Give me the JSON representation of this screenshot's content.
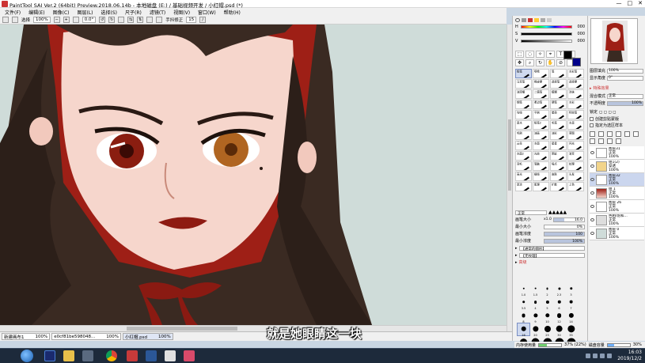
{
  "window": {
    "title": "PaintTool SAI Ver.2 (64bit) Preview.2018.06.14b - 本地磁盘 (E:) / 基础视频开发 / 小红帽.psd (*)",
    "minimize": "—",
    "maximize": "□",
    "close": "✕"
  },
  "menu": [
    "文件(F)",
    "编辑(E)",
    "图像(C)",
    "图层(L)",
    "选择(S)",
    "尺子(R)",
    "滤镜(T)",
    "视图(V)",
    "窗口(W)",
    "帮助(H)"
  ],
  "toolbar": {
    "selection_label": "选择",
    "zoom": "100%",
    "angle": "0.0°",
    "stabilizer_label": "手抖修正",
    "stabilizer_value": "15"
  },
  "documents": [
    {
      "name": "新建画布1",
      "zoom": "100%"
    },
    {
      "name": "e0cf81be598048...",
      "zoom": "100%"
    },
    {
      "name": "小红帽.psd",
      "zoom": "100%"
    }
  ],
  "subtitle": "就是她眼睛这一块",
  "color_sliders": [
    {
      "label": "H",
      "value": "000"
    },
    {
      "label": "S",
      "value": "000"
    },
    {
      "label": "V",
      "value": "000"
    }
  ],
  "colors": {
    "fg": "#000000",
    "bg": "#ffffff",
    "accent_blue": "#00008a",
    "canvas_bg": "#cfdcd9",
    "hood_red": "#9e1f16",
    "skin": "#f6d6cc",
    "hair": "#3a2a22"
  },
  "brushes": [
    "铅笔",
    "喷枪",
    "笔",
    "水彩笔",
    "马克笔",
    "橡皮擦",
    "选择笔",
    "选择擦",
    "油漆桶",
    "二值笔",
    "模糊",
    "涂抹",
    "钢笔",
    "柔边笔",
    "硬笔",
    "水彩",
    "勾线",
    "平刷",
    "晕染",
    "特效笔",
    "墨水",
    "铅笔2",
    "毛笔",
    "水墨",
    "毛刷",
    "油画",
    "油彩",
    "草图",
    "云朵",
    "水面",
    "星星",
    "闪光",
    "水面2",
    "光效",
    "阴影",
    "渐变",
    "羽毛",
    "笔触",
    "噪点",
    "纹理",
    "高光",
    "细线",
    "皮肤",
    "头发",
    "厚涂",
    "肌理",
    "扩散",
    "上色"
  ],
  "brush_props": {
    "mode_label": "正常",
    "size_label": "画笔大小",
    "size_mult": "x1.0",
    "size_value": "16.0",
    "min_size_label": "最小大小",
    "min_size_value": "0%",
    "density_label": "画笔浓度",
    "density_value": "100",
    "min_density_label": "最小浓度",
    "min_density_value": "100%",
    "shape_label": "【通常的圆形】",
    "texture_label": "【无纹理】",
    "advanced_label": "高级"
  },
  "brush_sizes": [
    "1.0",
    "1.5",
    "2",
    "2.3",
    "3",
    "3.5",
    "4",
    "5",
    "6",
    "7",
    "8",
    "9",
    "10",
    "12",
    "14",
    "16",
    "20",
    "25",
    "30",
    "35",
    "40",
    "50",
    "60",
    "70",
    "80"
  ],
  "right_panel": {
    "fill_label": "图层填充",
    "fill_value": "100%",
    "scale_label": "显示角度",
    "scale_value": "0°",
    "effect_label": "特殊效果",
    "blend_label": "混合模式",
    "blend_value": "正常",
    "opacity_label": "不透明度",
    "opacity_value": "100%",
    "lock_label": "锁定",
    "clip_label": "创建剪贴蒙版",
    "ref_label": "指定为选区样本"
  },
  "layers": [
    {
      "name": "图层31",
      "mode": "正常",
      "opacity": "100%"
    },
    {
      "name": "组1(2)",
      "mode": "穿透",
      "opacity": "100%"
    },
    {
      "name": "图层32",
      "mode": "正常",
      "opacity": "100%"
    },
    {
      "name": "组 1",
      "mode": "正常",
      "opacity": "100%"
    },
    {
      "name": "图层 26",
      "mode": "正常",
      "opacity": "100%"
    },
    {
      "name": "色相/饱和...",
      "mode": "正常",
      "opacity": "100%"
    },
    {
      "name": "图层 0",
      "mode": "正常",
      "opacity": "100%"
    }
  ],
  "status": {
    "memory_label": "内存使用量",
    "memory_value": "37% (22%)",
    "disk_label": "磁盘容量",
    "disk_value": "30%"
  },
  "clock": {
    "time": "16:03",
    "date": "2019/12/2"
  }
}
